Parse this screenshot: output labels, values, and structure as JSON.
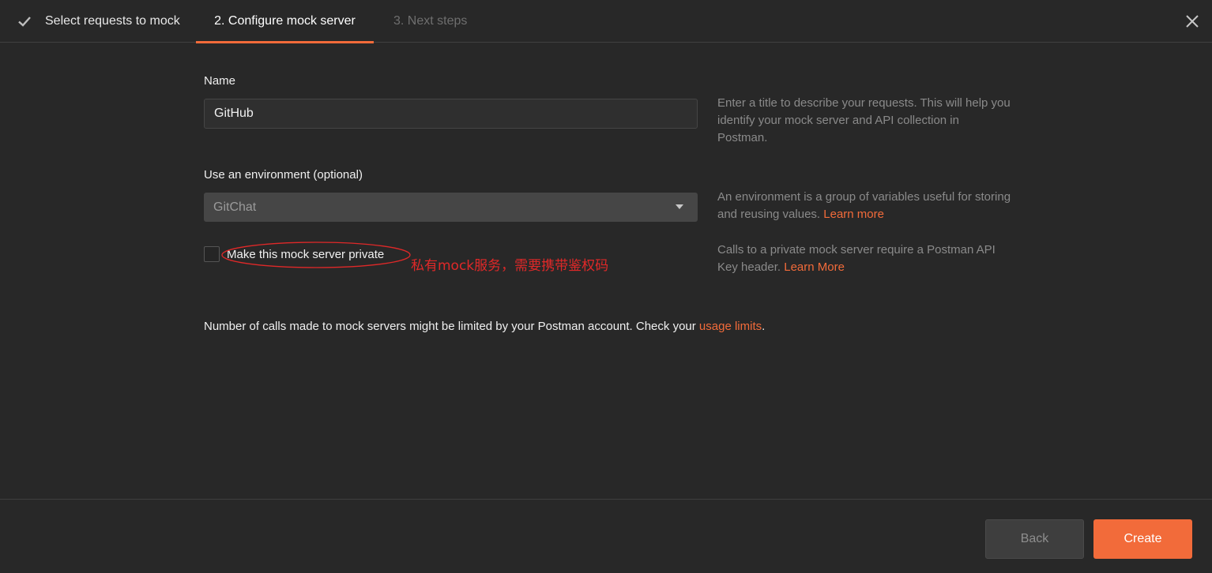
{
  "tabs": [
    {
      "label": "Select requests to mock",
      "state": "completed",
      "icon": "check-icon"
    },
    {
      "label": "2. Configure mock server",
      "state": "active"
    },
    {
      "label": "3. Next steps",
      "state": "disabled"
    }
  ],
  "close_icon": "close-icon",
  "form": {
    "name_label": "Name",
    "name_value": "GitHub",
    "name_help": "Enter a title to describe your requests. This will help you identify your mock server and API collection in Postman.",
    "env_label": "Use an environment (optional)",
    "env_value": "GitChat",
    "env_help_text": "An environment is a group of variables useful for storing and reusing values. ",
    "env_help_link": "Learn more",
    "private_label": "Make this mock server private",
    "private_checked": false,
    "private_help_text": "Calls to a private mock server require a Postman API Key header. ",
    "private_help_link": "Learn More",
    "annotation": "私有mock服务，需要携带鉴权码"
  },
  "limits": {
    "text": "Number of calls made to mock servers might be limited by your Postman account. Check your ",
    "link": "usage limits",
    "suffix": "."
  },
  "footer": {
    "back_label": "Back",
    "create_label": "Create"
  },
  "colors": {
    "accent": "#f26b3a",
    "background": "#282828",
    "annotation": "#e02828"
  }
}
